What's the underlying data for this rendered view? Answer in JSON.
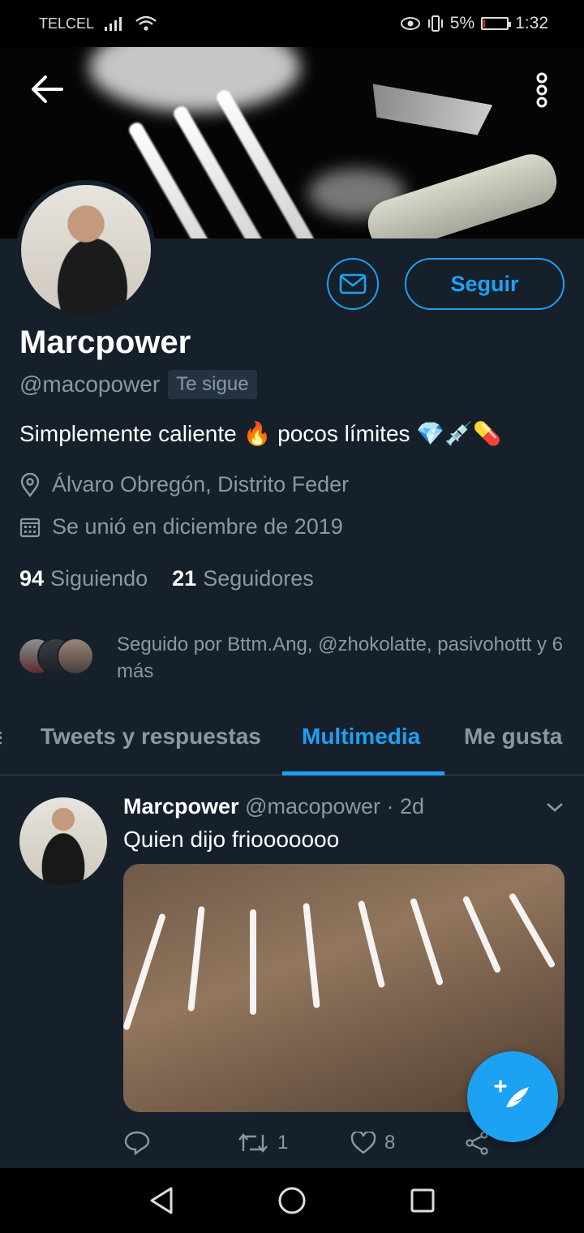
{
  "status": {
    "carrier": "TELCEL",
    "battery": "5%",
    "time": "1:32"
  },
  "profile": {
    "name": "Marcpower",
    "handle": "@macopower",
    "follows_you": "Te sigue",
    "bio": "Simplemente caliente 🔥 pocos límites 💎💉💊",
    "location": "Álvaro Obregón, Distrito Feder",
    "joined": "Se unió en diciembre de 2019",
    "following_count": "94",
    "following_label": "Siguiendo",
    "followers_count": "21",
    "followers_label": "Seguidores",
    "followed_by": "Seguido por Bttm.Ang, @zhokolatte, pasivohottt y 6 más",
    "follow_button": "Seguir"
  },
  "tabs": [
    {
      "label": "Tweets y respuestas"
    },
    {
      "label": "Multimedia"
    },
    {
      "label": "Me gusta"
    }
  ],
  "tweet": {
    "name": "Marcpower",
    "handle_time": "@macopower · 2d",
    "text": "Quien dijo friooooooo",
    "retweets": "1",
    "likes": "8"
  },
  "colors": {
    "accent": "#1da1f2",
    "background": "#15202b",
    "secondary_text": "#8899a6"
  }
}
